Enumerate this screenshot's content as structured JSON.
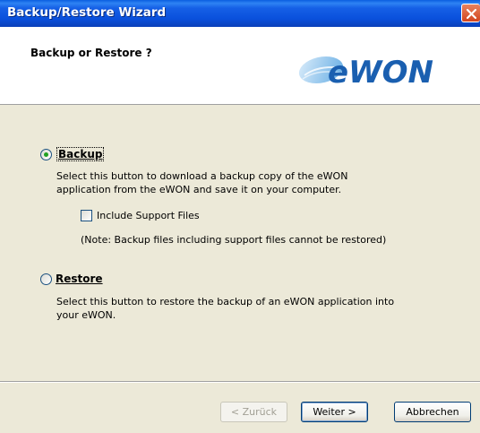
{
  "window": {
    "title": "Backup/Restore Wizard"
  },
  "header": {
    "title": "Backup or Restore ?",
    "logo_text": "eWON"
  },
  "options": {
    "backup": {
      "label": "Backup",
      "selected": true,
      "description_line1": "Select this button to download a backup copy of the eWON",
      "description_line2": "application from the eWON and save it on your computer.",
      "include_support": {
        "label": "Include Support Files",
        "checked": false
      },
      "note": "(Note: Backup files including support files cannot be restored)"
    },
    "restore": {
      "label": "Restore",
      "selected": false,
      "description_line1": "Select this button to restore the backup of an eWON application into",
      "description_line2": "your eWON."
    }
  },
  "buttons": {
    "back": "< Zurück",
    "next": "Weiter >",
    "cancel": "Abbrechen"
  },
  "colors": {
    "titlebar": "#0a50dc",
    "logo_blue": "#1a5fb0",
    "logo_light": "#8fc4ec",
    "radio_dot": "#21a121"
  }
}
